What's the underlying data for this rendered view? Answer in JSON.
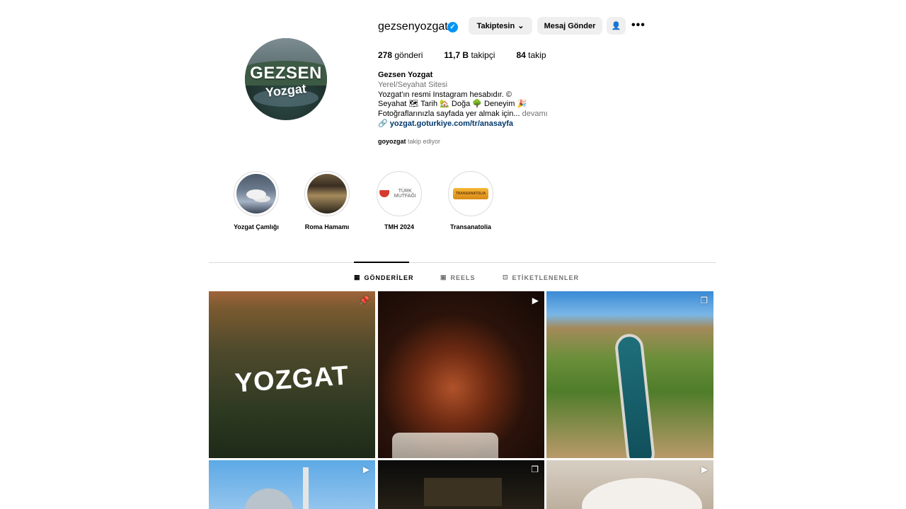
{
  "profile": {
    "username": "gezsenyozgat",
    "avatar_text_line1": "GEZSEN",
    "avatar_text_line2": "Yozgat",
    "follow_button": "Takiptesin",
    "message_button": "Mesaj Gönder",
    "stats": {
      "posts_count": "278",
      "posts_label": "gönderi",
      "followers_count": "11,7 B",
      "followers_label": "takipçi",
      "following_count": "84",
      "following_label": "takip"
    },
    "bio": {
      "name": "Gezsen Yozgat",
      "category": "Yerel/Seyahat Sitesi",
      "line1": "Yozgat'ın resmi Instagram hesabıdır. ©",
      "line2": "Seyahat 🗺 Tarih 🏡 Doğa 🌳 Deneyim 🎉",
      "line3": "Fotoğraflarınızla sayfada yer almak için...",
      "more": "devamı",
      "link": "yozgat.goturkiye.com/tr/anasayfa"
    },
    "followed_by_user": "goyozgat",
    "followed_by_text": "takip ediyor"
  },
  "highlights": [
    {
      "label": "Yozgat Çamlığı"
    },
    {
      "label": "Roma Hamamı"
    },
    {
      "label": "TMH 2024",
      "logo_text": "TÜRK MUTFAĞI"
    },
    {
      "label": "Transanatolia",
      "logo_text": "TRANSANATOLIA"
    }
  ],
  "tabs": [
    {
      "label": "GÖNDERİLER",
      "active": true
    },
    {
      "label": "REELS",
      "active": false
    },
    {
      "label": "ETİKETLENENLER",
      "active": false
    }
  ],
  "posts": {
    "first_post_text": "YOZGAT"
  },
  "colors": {
    "verified": "#0095f6",
    "link": "#00376b",
    "secondary_text": "#737373"
  }
}
